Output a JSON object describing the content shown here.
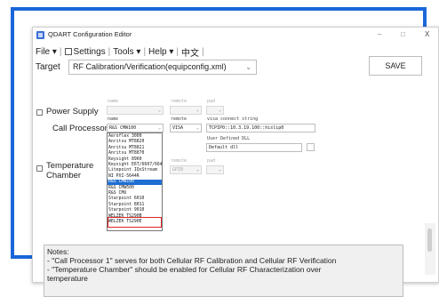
{
  "window": {
    "title": "QDART Configuration Editor",
    "minimize": "–",
    "maximize": "□",
    "close": "X"
  },
  "menu": {
    "file": "File ▾",
    "settings": "Settings",
    "tools": "Tools ▾",
    "help": "Help ▾",
    "lang": "中文",
    "sep": "|"
  },
  "target": {
    "label": "Target",
    "value": "RF Calibration/Verification(equipconfig.xml)"
  },
  "save": "SAVE",
  "power_supply": {
    "label": "Power Supply",
    "name_header": "name",
    "remote_header": "remote",
    "pad_header": "pad"
  },
  "call_processor": {
    "label": "Call Processor 1",
    "name_header": "name",
    "remote_header": "remote",
    "visa_header": "visa connect string",
    "name_value": "R&S CMW100",
    "remote_value": "VISA",
    "visa_value": "TCPIP0::10.3.19.100::hislip0",
    "user_dll_label": "User Defined DLL",
    "dll_value": "Default dll"
  },
  "temperature_chamber": {
    "label_line1": "Temperature",
    "label_line2": "Chamber",
    "remote_header": "remote",
    "pad_header": "pad",
    "remote_value": "GPIB"
  },
  "dropdown_items": [
    "Aeroflex 3000",
    "Anritsu MT8820",
    "Anritsu MT8821",
    "Anritsu MT8870",
    "Keysight 8960",
    "Keysight E6T/6607/6640",
    "Litepoint IQxStream",
    "NI PXI-5644R",
    "R&S CMW100",
    "R&S CMW500",
    "R&S CMU",
    "Starpoint 6010",
    "Starpoint 8011",
    "Starpoint 9010",
    "WELZEK TS290B",
    "WELZEK TS290E"
  ],
  "dropdown_selected_index": 8,
  "notes": {
    "title": "Notes:",
    "line1": "- \"Call Processor 1\" serves for both Cellular RF Calibration and Cellular RF Verification",
    "line2": "- \"Temperature Chamber\" should be enabled for Cellular RF Characterization over",
    "line3": "temperature"
  },
  "colors": {
    "frame": "#1a66d9",
    "selection": "#1e6fd2",
    "highlight": "#e02424"
  }
}
